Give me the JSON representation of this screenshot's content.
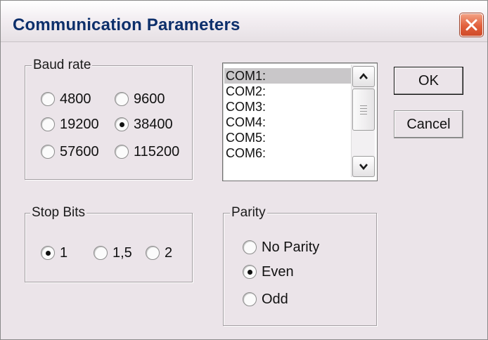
{
  "window": {
    "title": "Communication Parameters",
    "close_icon": "close-icon"
  },
  "baud_rate": {
    "label": "Baud rate",
    "options": [
      "4800",
      "9600",
      "19200",
      "38400",
      "57600",
      "115200"
    ],
    "selected": "38400"
  },
  "ports": {
    "items": [
      "COM1:",
      "COM2:",
      "COM3:",
      "COM4:",
      "COM5:",
      "COM6:"
    ],
    "selected": "COM1:"
  },
  "buttons": {
    "ok": "OK",
    "cancel": "Cancel"
  },
  "stop_bits": {
    "label": "Stop Bits",
    "options": [
      "1",
      "1,5",
      "2"
    ],
    "selected": "1"
  },
  "parity": {
    "label": "Parity",
    "options": [
      "No Parity",
      "Even",
      "Odd"
    ],
    "selected": "Even"
  },
  "colors": {
    "title_text": "#0d2f6b",
    "close_button": "#e2603c",
    "dialog_bg": "#ebe4e9"
  }
}
